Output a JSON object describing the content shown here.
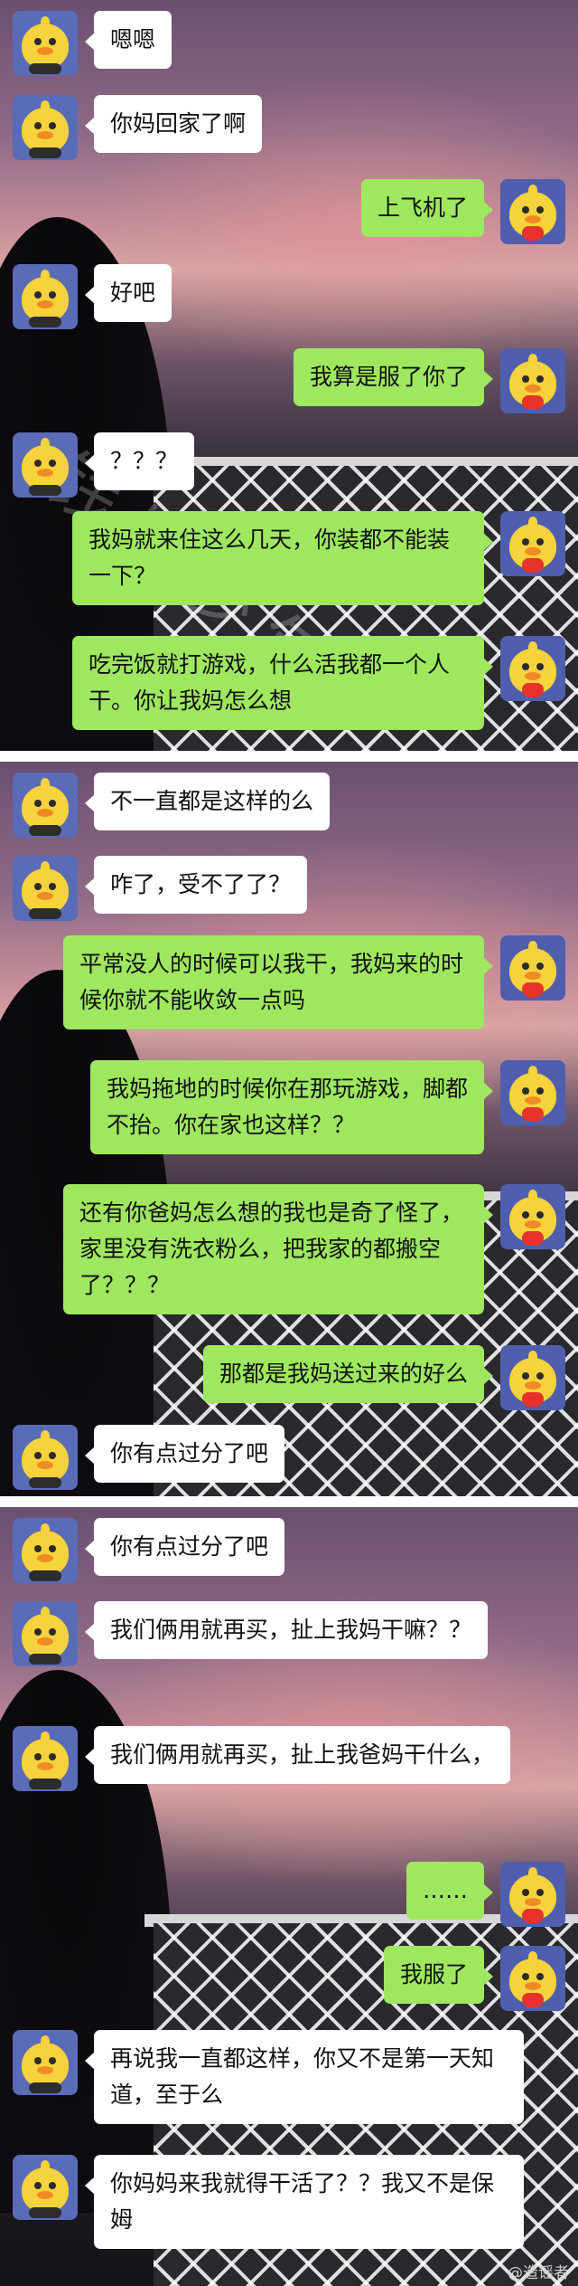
{
  "panels": [
    {
      "messages": [
        {
          "side": "left",
          "text": "嗯嗯"
        },
        {
          "side": "left",
          "text": "你妈回家了啊"
        },
        {
          "side": "right",
          "text": "上飞机了"
        },
        {
          "side": "left",
          "text": "好吧"
        },
        {
          "side": "right",
          "text": "我算是服了你了"
        },
        {
          "side": "left",
          "text": "？？？"
        },
        {
          "side": "right",
          "text": "我妈就来住这么几天，你装都不能装一下？"
        },
        {
          "side": "right",
          "text": "吃完饭就打游戏，什么活我都一个人干。你让我妈怎么想"
        }
      ]
    },
    {
      "messages": [
        {
          "side": "left",
          "text": "不一直都是这样的么"
        },
        {
          "side": "left",
          "text": "咋了，受不了了？"
        },
        {
          "side": "right",
          "text": "平常没人的时候可以我干，我妈来的时候你就不能收敛一点吗"
        },
        {
          "side": "right",
          "text": "我妈拖地的时候你在那玩游戏，脚都不抬。你在家也这样？？"
        },
        {
          "side": "right",
          "text": "还有你爸妈怎么想的我也是奇了怪了，家里没有洗衣粉么，把我家的都搬空了？？？"
        },
        {
          "side": "right",
          "text": "那都是我妈送过来的好么"
        },
        {
          "side": "left",
          "text": "你有点过分了吧"
        }
      ]
    },
    {
      "messages": [
        {
          "side": "left",
          "text": "你有点过分了吧"
        },
        {
          "side": "left",
          "text": "我们俩用就再买，扯上我妈干嘛？？"
        },
        {
          "side": "left",
          "text": "我们俩用就再买，扯上我爸妈干什么，"
        },
        {
          "side": "right",
          "text": "……"
        },
        {
          "side": "right",
          "text": "我服了"
        },
        {
          "side": "left",
          "text": "再说我一直都这样，你又不是第一天知道，至于么"
        },
        {
          "side": "left",
          "text": "你妈妈来我就得干活了？？我又不是保姆"
        }
      ]
    }
  ],
  "watermark": "钱塘少年",
  "weibo_watermark": "@造谣者"
}
